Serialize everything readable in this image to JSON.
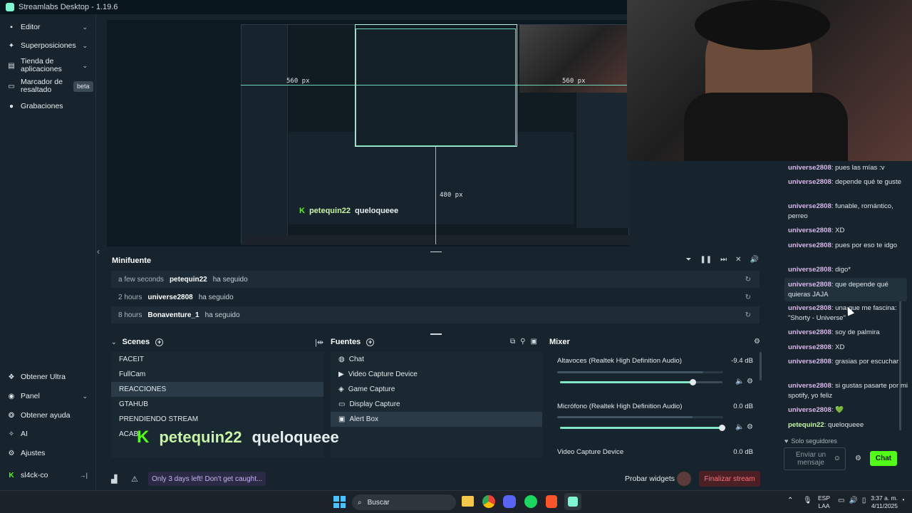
{
  "app": {
    "title": "Streamlabs Desktop - 1.19.6"
  },
  "sidebar": {
    "top": [
      {
        "label": "Editor"
      },
      {
        "label": "Superposiciones"
      },
      {
        "label": "Tienda de aplicaciones"
      },
      {
        "label": "Marcador de resaltado",
        "badge": "beta"
      },
      {
        "label": "Grabaciones"
      }
    ],
    "bottom": [
      {
        "label": "Obtener Ultra"
      },
      {
        "label": "Panel"
      },
      {
        "label": "Obtener ayuda"
      },
      {
        "label": "AI"
      },
      {
        "label": "Ajustes"
      },
      {
        "label": "sl4ck-co"
      }
    ]
  },
  "preview": {
    "dim_left": "560 px",
    "dim_right": "560 px",
    "dim_bottom": "480 px",
    "overlay_user": "petequin22",
    "overlay_msg": "queloqueee"
  },
  "minifuente": {
    "title": "Minifuente",
    "events": [
      {
        "time": "a few seconds",
        "user": "petequin22",
        "action": "ha seguido"
      },
      {
        "time": "2 hours",
        "user": "universe2808",
        "action": "ha seguido"
      },
      {
        "time": "8 hours",
        "user": "Bonaventure_1",
        "action": "ha seguido"
      }
    ]
  },
  "scenes": {
    "title": "Scenes",
    "items": [
      "FACEIT",
      "FullCam",
      "REACCIONES",
      "GTAHUB",
      "PRENDIENDO STREAM",
      "ACAB"
    ],
    "selected": "REACCIONES"
  },
  "sources": {
    "title": "Fuentes",
    "items": [
      "Chat",
      "Video Capture Device",
      "Game Capture",
      "Display Capture",
      "Alert Box"
    ],
    "selected": "Alert Box"
  },
  "mixer": {
    "title": "Mixer",
    "channels": [
      {
        "name": "Altavoces (Realtek High Definition Audio)",
        "db": "-9.4 dB",
        "level": 0.82
      },
      {
        "name": "Micrófono (Realtek High Definition Audio)",
        "db": "0.0 dB",
        "level": 1.0
      },
      {
        "name": "Video Capture Device",
        "db": "0.0 dB",
        "level": 1.0
      }
    ]
  },
  "footer": {
    "notice": "Only 3 days left! Don't get caught...",
    "test_widgets": "Probar widgets",
    "end_stream": "Finalizar stream"
  },
  "chat": {
    "messages": [
      {
        "user": "universe2808",
        "text": "pues las mías :v"
      },
      {
        "user": "universe2808",
        "text": "depende qué te guste"
      },
      {
        "user": "universe2808",
        "text": "funable, romántico, perreo"
      },
      {
        "user": "universe2808",
        "text": "XD"
      },
      {
        "user": "universe2808",
        "text": "pues por eso te idgo"
      },
      {
        "user": "universe2808",
        "text": "digo*"
      },
      {
        "user": "universe2808",
        "text": "que depende qué quieras JAJA"
      },
      {
        "user": "universe2808",
        "text": "una que me fascina: \"Shorty - Universe\""
      },
      {
        "user": "universe2808",
        "text": "soy de palmira"
      },
      {
        "user": "universe2808",
        "text": "XD"
      },
      {
        "user": "universe2808",
        "text": "grasias por escuchar"
      },
      {
        "user": "universe2808",
        "text": "si gustas pasarte por mi spotify, yo feliz"
      },
      {
        "user": "universe2808",
        "text": "💚"
      },
      {
        "user": "petequin22",
        "text": "queloqueee"
      }
    ],
    "followers_only": "Solo seguidores",
    "input_placeholder": "Enviar un mensaje",
    "send": "Chat"
  },
  "taskbar": {
    "search": "Buscar",
    "lang1": "ESP",
    "lang2": "LAA",
    "time": "3:37 a. m.",
    "date": "4/11/2025"
  }
}
